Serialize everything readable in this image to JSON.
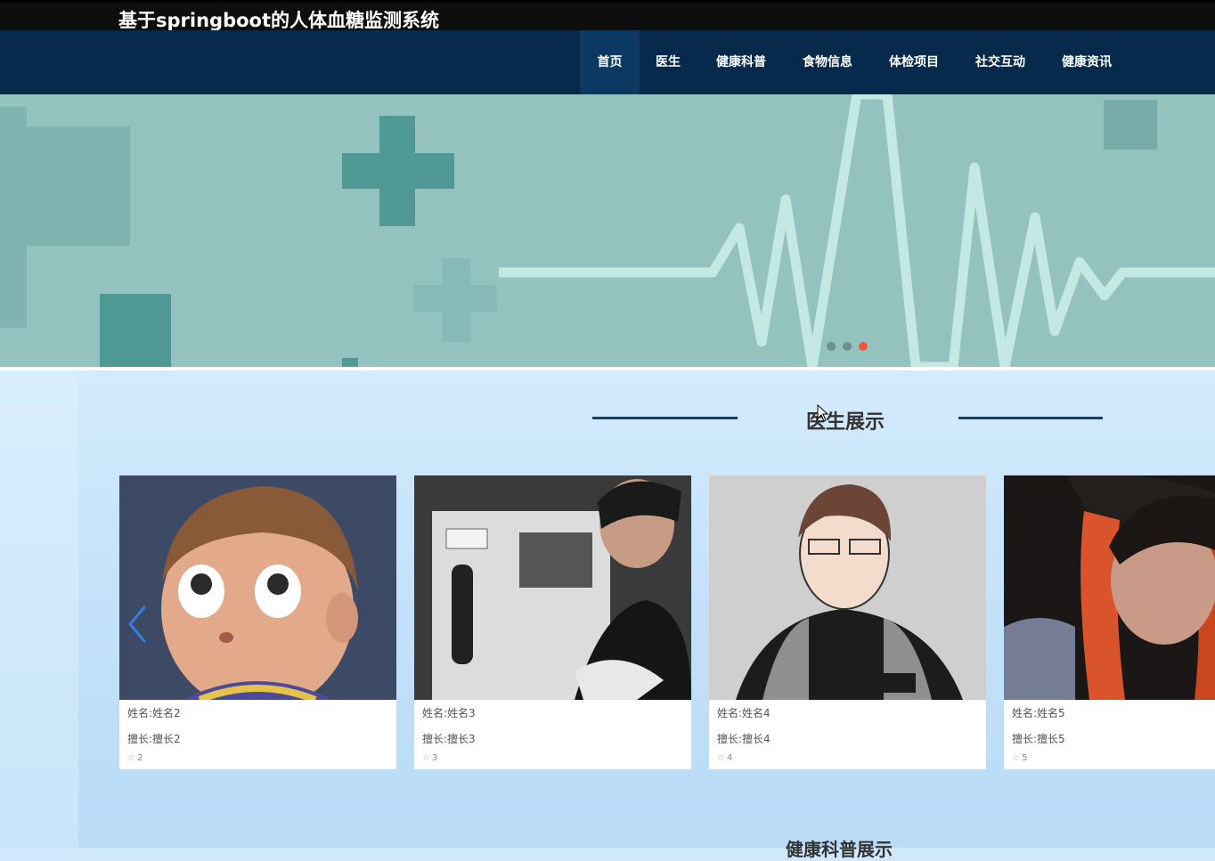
{
  "header": {
    "site_title": "基于springboot的人体血糖监测系统"
  },
  "nav": {
    "items": [
      {
        "label": "首页",
        "active": true
      },
      {
        "label": "医生"
      },
      {
        "label": "健康科普"
      },
      {
        "label": "食物信息"
      },
      {
        "label": "体检项目"
      },
      {
        "label": "社交互动"
      },
      {
        "label": "健康资讯"
      }
    ]
  },
  "banner": {
    "slide_count": 3,
    "active_slide": 3
  },
  "doctor_section": {
    "title": "医生展示",
    "cards": [
      {
        "name": "姓名:姓名2",
        "specialty": "擅长:擅长2",
        "likes": "2"
      },
      {
        "name": "姓名:姓名3",
        "specialty": "擅长:擅长3",
        "likes": "3"
      },
      {
        "name": "姓名:姓名4",
        "specialty": "擅长:擅长4",
        "likes": "4"
      },
      {
        "name": "姓名:姓名5",
        "specialty": "擅长:擅长5",
        "likes": "5"
      }
    ]
  },
  "next_section": {
    "title": "健康科普展示"
  },
  "colors": {
    "nav_bg": "#072a4c",
    "banner_bg": "#94c3bf",
    "accent_dot": "#f0563b"
  }
}
